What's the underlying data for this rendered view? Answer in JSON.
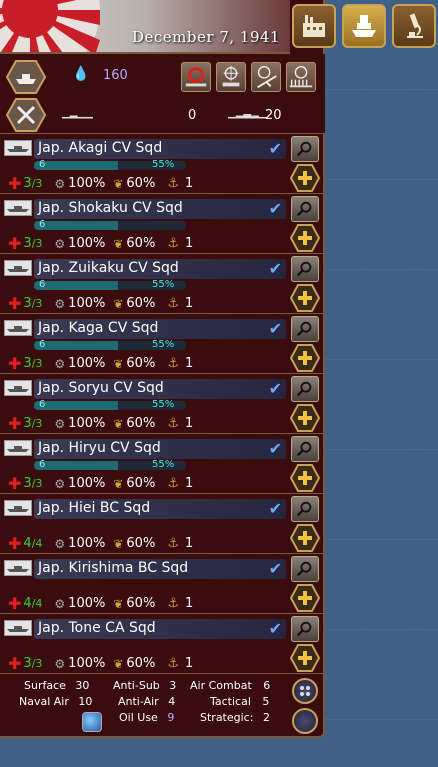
{
  "header": {
    "date": "December 7, 1941",
    "buttons": [
      {
        "name": "production-button",
        "icon": "factory-icon"
      },
      {
        "name": "naval-button",
        "icon": "ship-icon",
        "active": true
      },
      {
        "name": "research-button",
        "icon": "microscope-icon"
      }
    ]
  },
  "summary": {
    "fuel": "160",
    "submarines": "0",
    "transports": "20"
  },
  "units": [
    {
      "name": "Jap. Akagi CV Sqd",
      "level": "6",
      "xp": "55%",
      "xp_frac": 0.55,
      "str": "3",
      "str_max": "3",
      "supply": "100%",
      "morale": "60%",
      "crew": "1",
      "show_xp": true
    },
    {
      "name": "Jap. Shokaku CV Sqd",
      "level": "6",
      "xp": "55%",
      "xp_frac": 0.55,
      "str": "3",
      "str_max": "3",
      "supply": "100%",
      "morale": "60%",
      "crew": "1",
      "show_xp": false
    },
    {
      "name": "Jap. Zuikaku CV Sqd",
      "level": "6",
      "xp": "55%",
      "xp_frac": 0.55,
      "str": "3",
      "str_max": "3",
      "supply": "100%",
      "morale": "60%",
      "crew": "1",
      "show_xp": true
    },
    {
      "name": "Jap. Kaga CV Sqd",
      "level": "6",
      "xp": "55%",
      "xp_frac": 0.55,
      "str": "3",
      "str_max": "3",
      "supply": "100%",
      "morale": "60%",
      "crew": "1",
      "show_xp": true
    },
    {
      "name": "Jap. Soryu CV Sqd",
      "level": "6",
      "xp": "55%",
      "xp_frac": 0.55,
      "str": "3",
      "str_max": "3",
      "supply": "100%",
      "morale": "60%",
      "crew": "1",
      "show_xp": true
    },
    {
      "name": "Jap. Hiryu CV Sqd",
      "level": "6",
      "xp": "55%",
      "xp_frac": 0.55,
      "str": "3",
      "str_max": "3",
      "supply": "100%",
      "morale": "60%",
      "crew": "1",
      "show_xp": true
    },
    {
      "name": "Jap. Hiei BC Sqd",
      "level": "",
      "xp": "",
      "xp_frac": 0,
      "str": "4",
      "str_max": "4",
      "supply": "100%",
      "morale": "60%",
      "crew": "1",
      "show_xp": false
    },
    {
      "name": "Jap. Kirishima BC Sqd",
      "level": "",
      "xp": "",
      "xp_frac": 0,
      "str": "4",
      "str_max": "4",
      "supply": "100%",
      "morale": "60%",
      "crew": "1",
      "show_xp": false
    },
    {
      "name": "Jap. Tone CA Sqd",
      "level": "",
      "xp": "",
      "xp_frac": 0,
      "str": "3",
      "str_max": "3",
      "supply": "100%",
      "morale": "60%",
      "crew": "1",
      "show_xp": false
    }
  ],
  "footer": {
    "surface_label": "Surface",
    "surface": "30",
    "naval_air_label": "Naval Air",
    "naval_air": "10",
    "anti_sub_label": "Anti-Sub",
    "anti_sub": "3",
    "anti_air_label": "Anti-Air",
    "anti_air": "4",
    "oil_use_label": "Oil Use",
    "oil_use": "9",
    "air_combat_label": "Air Combat",
    "air_combat": "6",
    "tactical_label": "Tactical",
    "tactical": "5",
    "strategic_label": "Strategic:",
    "strategic": "2"
  },
  "colors": {
    "panel": "#3a0c0e",
    "border": "#7a5a3a",
    "strength": "#38d038",
    "xp": "#4ee0e0",
    "oil": "#b8a8ff"
  }
}
